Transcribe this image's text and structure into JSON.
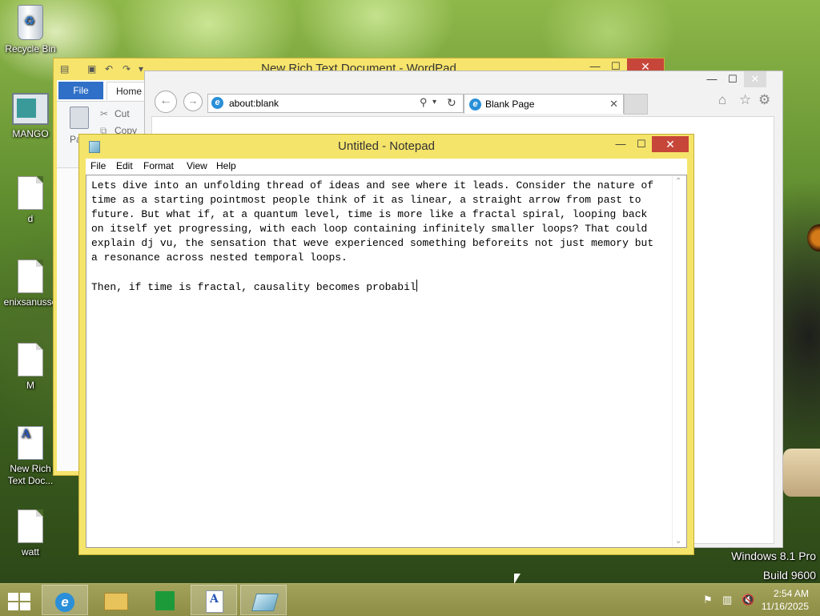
{
  "desktop": {
    "icons": [
      {
        "label": "Recycle Bin"
      },
      {
        "label": "MANGO"
      },
      {
        "label": "d"
      },
      {
        "label": "enixsanusso"
      },
      {
        "label": "M"
      },
      {
        "label": "New Rich Text Doc..."
      },
      {
        "label": "watt"
      }
    ],
    "watermark": {
      "line1": "Windows 8.1 Pro",
      "line2": "Build 9600"
    }
  },
  "wordpad": {
    "title": "New Rich Text Document - WordPad",
    "file_tab": "File",
    "home_tab": "Home",
    "paste_label": "Pa",
    "cut_label": "Cut",
    "copy_label": "Copy"
  },
  "ie": {
    "address": "about:blank",
    "tab_title": "Blank Page"
  },
  "notepad": {
    "title": "Untitled - Notepad",
    "menus": [
      "File",
      "Edit",
      "Format",
      "View",
      "Help"
    ],
    "text": "Lets dive into an unfolding thread of ideas and see where it leads. Consider the nature of\ntime as a starting pointmost people think of it as linear, a straight arrow from past to\nfuture. But what if, at a quantum level, time is more like a fractal spiral, looping back\non itself yet progressing, with each loop containing infinitely smaller loops? That could\nexplain dj vu, the sensation that weve experienced something beforeits not just memory but\na resonance across nested temporal loops.\n\nThen, if time is fractal, causality becomes probabil"
  },
  "taskbar": {
    "items": [
      "start-button",
      "internet-explorer",
      "file-explorer",
      "store",
      "wordpad",
      "notepad"
    ],
    "clock": {
      "time": "2:54 AM",
      "date": "11/16/2025"
    }
  }
}
